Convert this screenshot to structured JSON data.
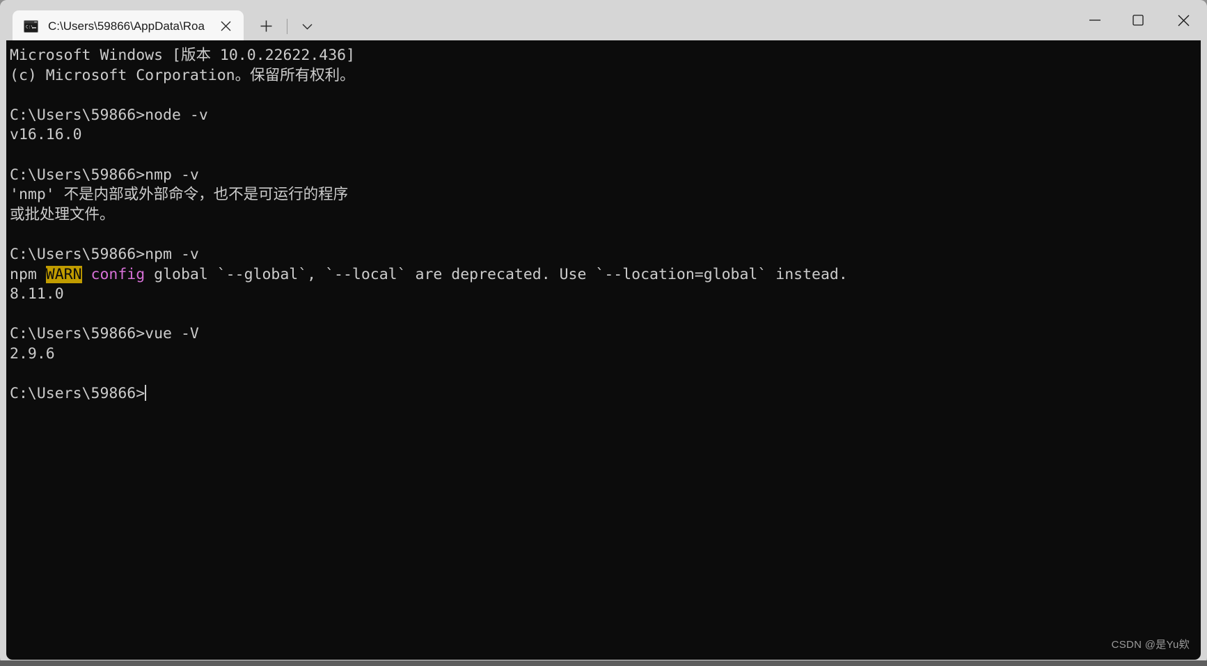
{
  "window": {
    "background_color": "#d6d6d6",
    "terminal_background": "#0c0c0c",
    "terminal_foreground": "#cccccc"
  },
  "titlebar": {
    "tab": {
      "icon": "cmd-console-icon",
      "title": "C:\\Users\\59866\\AppData\\Roa",
      "close_label": "✕"
    },
    "new_tab_label": "+",
    "dropdown_label": "⌄",
    "controls": {
      "minimize_label": "─",
      "maximize_label": "□",
      "close_label": "✕"
    }
  },
  "terminal": {
    "lines": [
      {
        "type": "text",
        "text": "Microsoft Windows [版本 10.0.22622.436]"
      },
      {
        "type": "text",
        "text": "(c) Microsoft Corporation。保留所有权利。"
      },
      {
        "type": "blank",
        "text": ""
      },
      {
        "type": "text",
        "text": "C:\\Users\\59866>node -v"
      },
      {
        "type": "text",
        "text": "v16.16.0"
      },
      {
        "type": "blank",
        "text": ""
      },
      {
        "type": "text",
        "text": "C:\\Users\\59866>nmp -v"
      },
      {
        "type": "text",
        "text": "'nmp' 不是内部或外部命令，也不是可运行的程序"
      },
      {
        "type": "text",
        "text": "或批处理文件。"
      },
      {
        "type": "blank",
        "text": ""
      },
      {
        "type": "text",
        "text": "C:\\Users\\59866>npm -v"
      },
      {
        "type": "warn",
        "prefix": "npm ",
        "badge": "WARN",
        "keyword": " config ",
        "rest": "global `--global`, `--local` are deprecated. Use `--location=global` instead."
      },
      {
        "type": "text",
        "text": "8.11.0"
      },
      {
        "type": "blank",
        "text": ""
      },
      {
        "type": "text",
        "text": "C:\\Users\\59866>vue -V"
      },
      {
        "type": "text",
        "text": "2.9.6"
      },
      {
        "type": "blank",
        "text": ""
      },
      {
        "type": "prompt",
        "text": "C:\\Users\\59866>"
      }
    ],
    "colors": {
      "warn_badge_bg": "#c19c00",
      "warn_badge_fg": "#0c0c0c",
      "keyword_fg": "#d670d6"
    }
  },
  "watermark": {
    "text": "CSDN @是Yu欸"
  }
}
